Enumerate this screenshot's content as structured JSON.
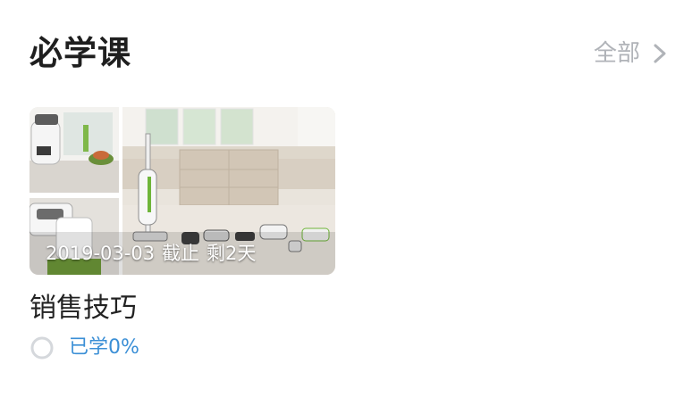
{
  "section": {
    "title": "必学课",
    "view_all_label": "全部",
    "view_all_icon": "chevron-right-icon"
  },
  "courses": [
    {
      "title": "销售技巧",
      "deadline_date": "2019-03-03",
      "deadline_label": "截止",
      "remaining": "剩2天",
      "progress_text": "已学0%",
      "progress_percent": 0,
      "progress_icon": "progress-ring-icon",
      "cover_image": "kitchen-appliances-photo"
    }
  ],
  "colors": {
    "title": "#1f1f1f",
    "muted": "#b0b3b8",
    "progress_accent": "#3b8fd6",
    "ring": "#d5d8dc"
  }
}
